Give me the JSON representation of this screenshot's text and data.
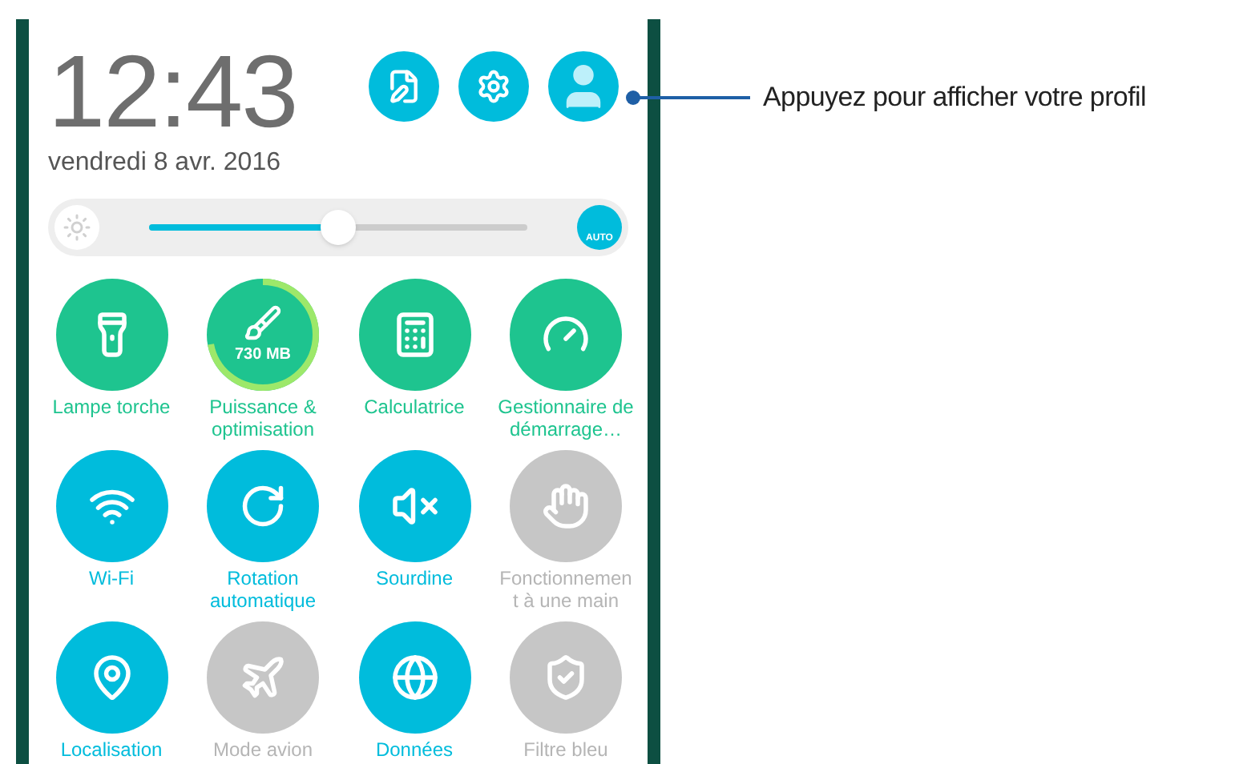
{
  "clock": {
    "time": "12:43",
    "date": "vendredi 8 avr. 2016"
  },
  "header_buttons": [
    {
      "kind": "edit"
    },
    {
      "kind": "settings"
    },
    {
      "kind": "profile"
    }
  ],
  "brightness": {
    "level": 0.5,
    "auto_label": "AUTO"
  },
  "tiles": [
    {
      "kind": "flashlight",
      "label": "Lampe torche",
      "on": true,
      "color": "#1ec48f"
    },
    {
      "kind": "cleaner",
      "label": "Puissance &\noptimisation",
      "on": true,
      "color": "#1ec48f",
      "badge": "730 MB"
    },
    {
      "kind": "calculator",
      "label": "Calculatrice",
      "on": true,
      "color": "#1ec48f"
    },
    {
      "kind": "boost",
      "label": "Gestionnaire de\ndémarrage…",
      "on": true,
      "color": "#1ec48f"
    },
    {
      "kind": "wifi",
      "label": "Wi-Fi",
      "on": true,
      "color": "#00bcdc"
    },
    {
      "kind": "rotation",
      "label": "Rotation\nautomatique",
      "on": true,
      "color": "#00bcdc"
    },
    {
      "kind": "mute",
      "label": "Sourdine",
      "on": true,
      "color": "#00bcdc"
    },
    {
      "kind": "onehand",
      "label": "Fonctionnemen\nt à une main",
      "on": false
    },
    {
      "kind": "location",
      "label": "Localisation",
      "on": true,
      "color": "#00bcdc"
    },
    {
      "kind": "airplane",
      "label": "Mode avion",
      "on": false
    },
    {
      "kind": "data",
      "label": "Données",
      "on": true,
      "color": "#00bcdc"
    },
    {
      "kind": "bluefilter",
      "label": "Filtre bleu",
      "on": false
    }
  ],
  "callout": {
    "text": "Appuyez pour afficher votre profil"
  }
}
